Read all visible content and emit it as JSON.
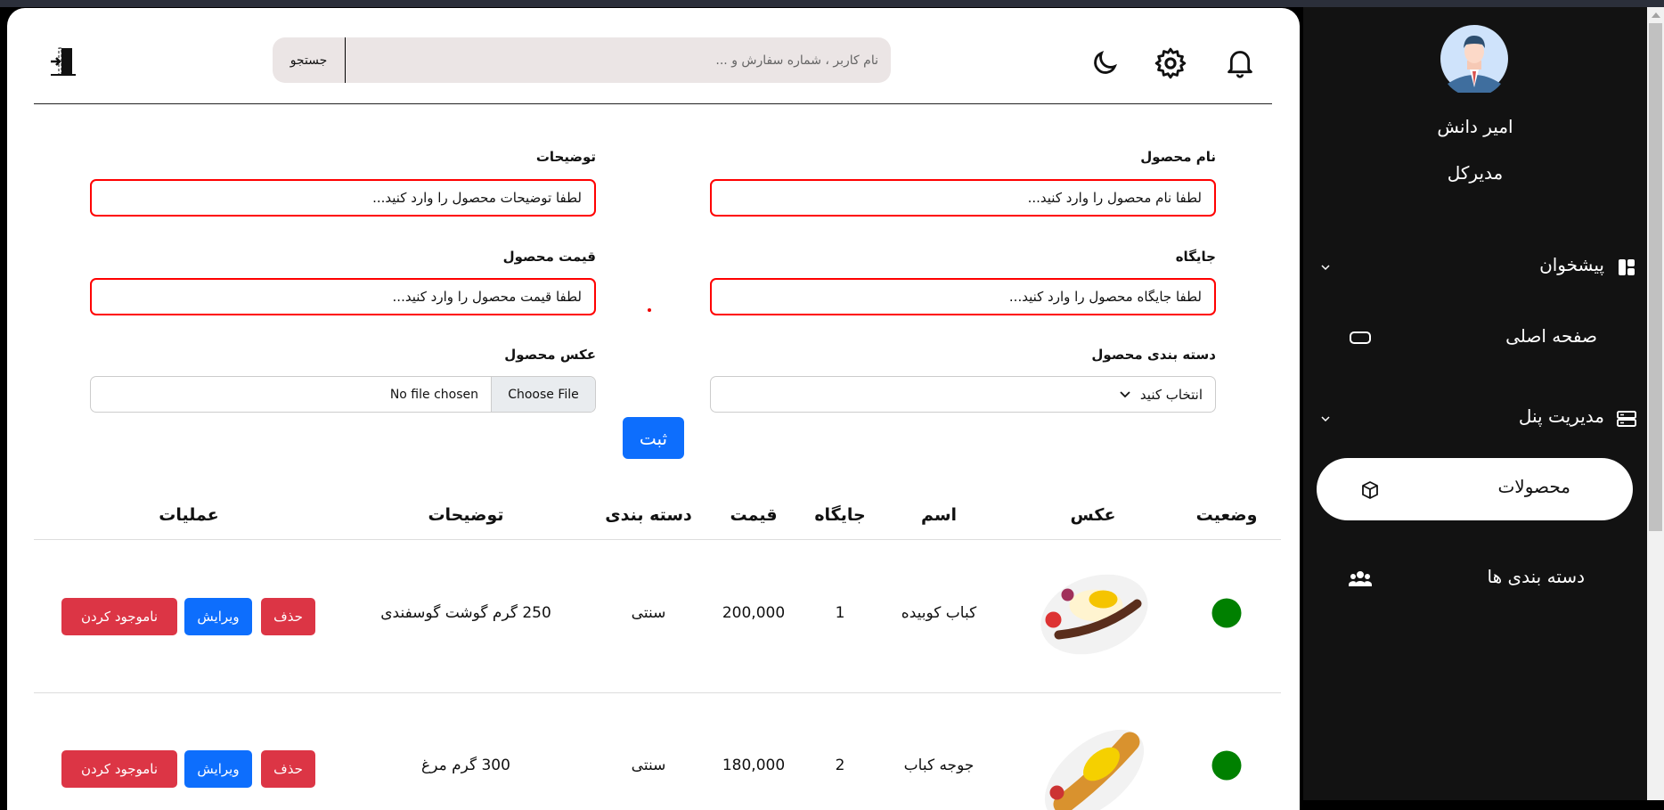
{
  "header": {
    "search_placeholder": "نام کاربر ، شماره سفارش و ...",
    "search_button": "جستجو"
  },
  "form": {
    "name_label": "نام محصول",
    "name_placeholder": "لطفا نام محصول را وارد کنید...",
    "desc_label": "توضیحات",
    "desc_placeholder": "لطفا توضیحات محصول را وارد کنید...",
    "position_label": "جایگاه",
    "position_placeholder": "لطفا جایگاه محصول را وارد کنید...",
    "price_label": "قیمت محصول",
    "price_placeholder": "لطفا قیمت محصول را وارد کنید...",
    "category_label": "دسته بندی محصول",
    "category_value": "انتخاب کنید",
    "image_label": "عکس محصول",
    "choose_file": "Choose File",
    "no_file": "No file chosen",
    "submit": "ثبت"
  },
  "table": {
    "headers": [
      "وضعیت",
      "عکس",
      "اسم",
      "جایگاه",
      "قیمت",
      "دسته بندی",
      "توضیحات",
      "عملیات"
    ],
    "rows": [
      {
        "name": "کباب کوبیده",
        "position": "1",
        "price": "200,000",
        "category": "سنتی",
        "description": "250 گرم گوشت گوسفندی",
        "status_color": "#008000"
      },
      {
        "name": "جوجه کباب",
        "position": "2",
        "price": "180,000",
        "category": "سنتی",
        "description": "300 گرم مرغ",
        "status_color": "#008000"
      }
    ],
    "actions": {
      "delete": "حذف",
      "edit": "ویرایش",
      "unavailable": "ناموجود کردن"
    }
  },
  "sidebar": {
    "user_name": "امیر دانش",
    "user_role": "مدیرکل",
    "items": [
      {
        "label": "پیشخوان",
        "icon": "dashboard-icon"
      },
      {
        "label": "صفحه اصلی",
        "icon": "monitor-icon"
      },
      {
        "label": "مدیریت پنل",
        "icon": "server-icon"
      },
      {
        "label": "محصولات",
        "icon": "box-icon",
        "active": true
      },
      {
        "label": "دسته بندی ها",
        "icon": "users-icon"
      }
    ]
  }
}
